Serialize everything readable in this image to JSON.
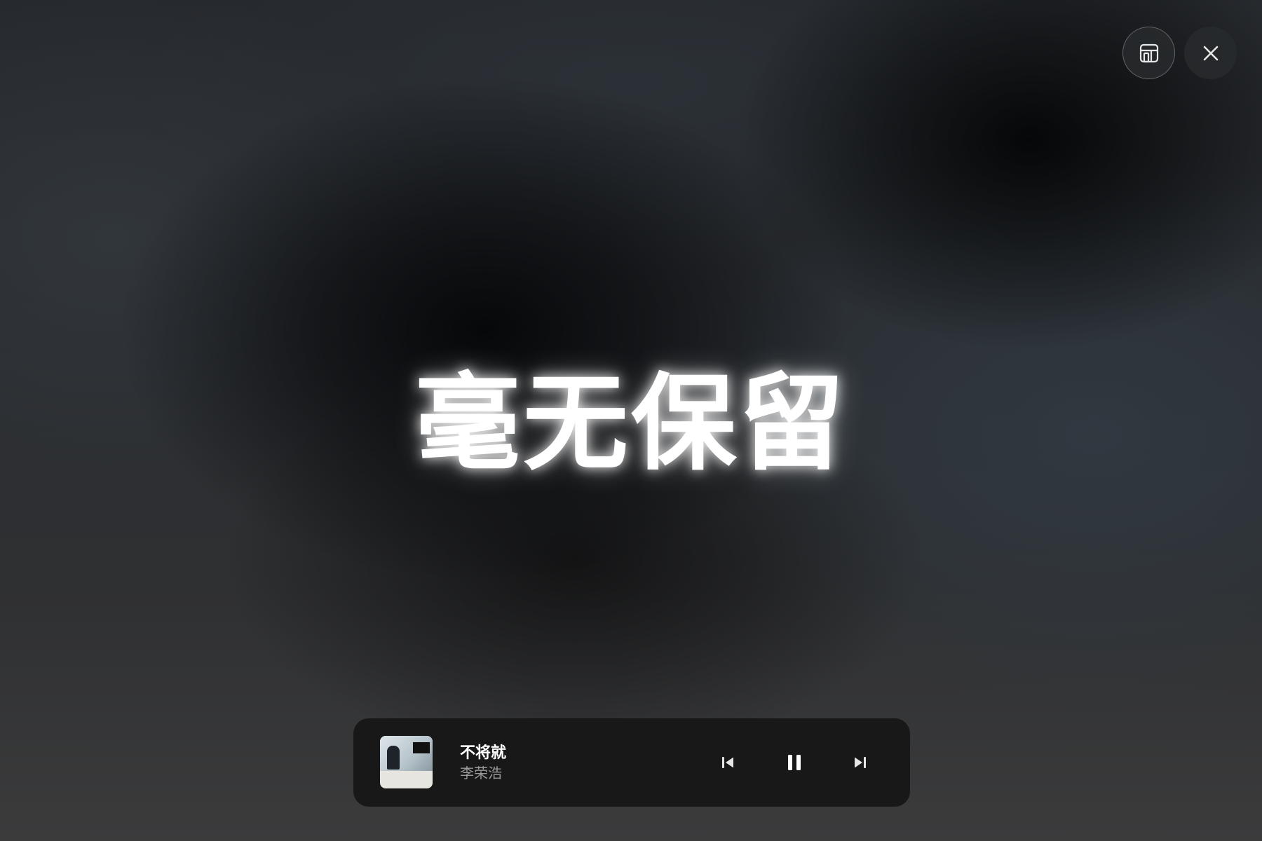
{
  "header": {
    "layout_button_icon": "layout-icon",
    "close_button_icon": "close-icon"
  },
  "lyrics": {
    "current_line": "毫无保留"
  },
  "player": {
    "cover_icon": "album-cover",
    "track_title": "不将就",
    "artist": "李荣浩",
    "state": "playing",
    "controls": {
      "previous_icon": "skip-previous-icon",
      "pause_icon": "pause-icon",
      "next_icon": "skip-next-icon"
    }
  },
  "colors": {
    "background_dark": "#1b1d20",
    "player_bar": "#181818",
    "lyric_text": "#ffffff",
    "artist_text": "#9a9a9a"
  }
}
